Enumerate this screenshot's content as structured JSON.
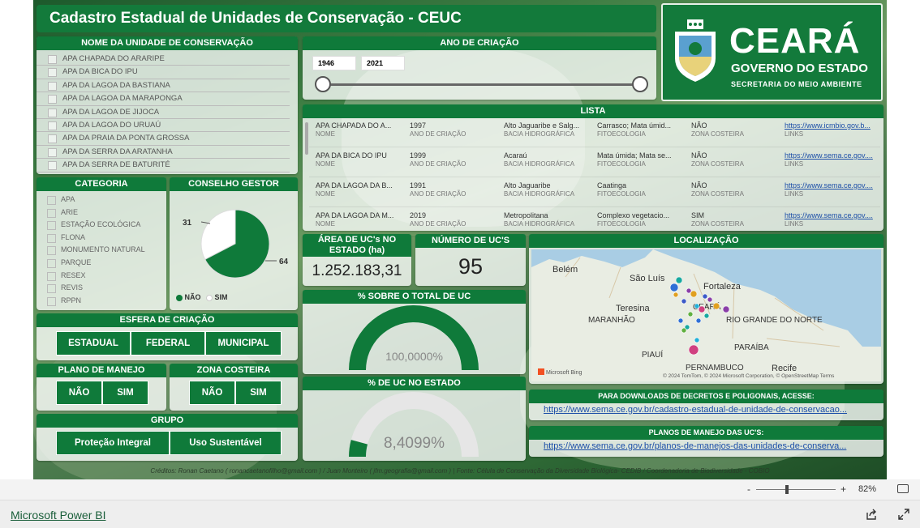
{
  "title": "Cadastro Estadual de Unidades de Conservação - CEUC",
  "logo": {
    "state": "CEARÁ",
    "gov": "GOVERNO DO ESTADO",
    "sec": "SECRETARIA DO MEIO AMBIENTE"
  },
  "nome_uc": {
    "header": "NOME DA UNIDADE DE CONSERVAÇÃO",
    "items": [
      "APA CHAPADA DO ARARIPE",
      "APA DA BICA DO IPU",
      "APA DA LAGOA DA BASTIANA",
      "APA DA LAGOA DA MARAPONGA",
      "APA DA LAGOA DE JIJOCA",
      "APA DA LAGOA DO URUAÚ",
      "APA DA PRAIA DA PONTA GROSSA",
      "APA DA SERRA DA ARATANHA",
      "APA DA SERRA DE BATURITÉ"
    ]
  },
  "ano": {
    "header": "ANO DE CRIAÇÃO",
    "min": "1946",
    "max": "2021"
  },
  "lista": {
    "header": "LISTA",
    "labels": {
      "nome": "NOME",
      "ano": "ANO DE CRIAÇÃO",
      "bacia": "BACIA HIDROGRÁFICA",
      "fito": "FITOECOLOGIA",
      "zona": "ZONA COSTEIRA",
      "links": "LINKS"
    },
    "rows": [
      {
        "nome": "APA CHAPADA DO A...",
        "ano": "1997",
        "bacia": "Alto Jaguaribe e Salg...",
        "fito": "Carrasco; Mata úmid...",
        "zona": "NÃO",
        "link": "https://www.icmbio.gov.b..."
      },
      {
        "nome": "APA DA BICA DO IPU",
        "ano": "1999",
        "bacia": "Acaraú",
        "fito": "Mata úmida; Mata se...",
        "zona": "NÃO",
        "link": "https://www.sema.ce.gov...."
      },
      {
        "nome": "APA DA LAGOA DA B...",
        "ano": "1991",
        "bacia": "Alto Jaguaribe",
        "fito": "Caatinga",
        "zona": "NÃO",
        "link": "https://www.sema.ce.gov...."
      },
      {
        "nome": "APA DA LAGOA DA M...",
        "ano": "2019",
        "bacia": "Metropolitana",
        "fito": "Complexo vegetacio...",
        "zona": "SIM",
        "link": "https://www.sema.ce.gov...."
      }
    ]
  },
  "categoria": {
    "header": "CATEGORIA",
    "items": [
      "APA",
      "ARIE",
      "ESTAÇÃO ECOLÓGICA",
      "FLONA",
      "MONUMENTO NATURAL",
      "PARQUE",
      "RESEX",
      "REVIS",
      "RPPN"
    ]
  },
  "conselho": {
    "header": "CONSELHO GESTOR",
    "nao": 64,
    "sim": 31,
    "nao_label": "NÃO",
    "sim_label": "SIM",
    "nao_color": "#0f7a3a",
    "sim_color": "#ffffff"
  },
  "area": {
    "header": "ÁREA DE UC's NO ESTADO (ha)",
    "value": "1.252.183,31"
  },
  "numero": {
    "header": "NÚMERO DE UC'S",
    "value": "95"
  },
  "pct_total": {
    "header": "% SOBRE O TOTAL DE UC",
    "value": "100,0000%",
    "fraction": 1.0
  },
  "pct_estado": {
    "header": "% DE UC NO ESTADO",
    "value": "8,4099%",
    "fraction": 0.084099
  },
  "esfera": {
    "header": "ESFERA DE CRIAÇÃO",
    "buttons": [
      "ESTADUAL",
      "FEDERAL",
      "MUNICIPAL"
    ]
  },
  "plano": {
    "header": "PLANO DE MANEJO",
    "buttons": [
      "NÃO",
      "SIM"
    ]
  },
  "zona": {
    "header": "ZONA COSTEIRA",
    "buttons": [
      "NÃO",
      "SIM"
    ]
  },
  "grupo": {
    "header": "GRUPO",
    "buttons": [
      "Proteção Integral",
      "Uso Sustentável"
    ]
  },
  "localizacao": {
    "header": "LOCALIZAÇÃO",
    "labels": [
      "Belém",
      "São Luís",
      "Fortaleza",
      "Teresina",
      "CEARÁ",
      "RIO GRANDE DO NORTE",
      "MARANHÃO",
      "PIAUÍ",
      "PARAÍBA",
      "PERNAMBUCO",
      "Recife"
    ],
    "attribution": "© 2024 TomTom, © 2024 Microsoft Corporation, © OpenStreetMap  Terms",
    "bing": "Microsoft Bing"
  },
  "downloads": {
    "header": "PARA DOWNLOADS DE DECRETOS E POLIGONAIS, ACESSE:",
    "link": "https://www.sema.ce.gov.br/cadastro-estadual-de-unidade-de-conservacao..."
  },
  "planos": {
    "header": "PLANOS DE MANEJO DAS UC'S:",
    "link": "https://www.sema.ce.gov.br/planos-de-manejos-das-unidades-de-conserva..."
  },
  "credits": "Créditos: Ronan Caetano ( ronancaetanofilho@gmail.com ) / Juan Monteiro ( jfm.geografia@gmail.com )  |  Fonte: Célula de Conservação da Diversidade Biológica- CEDIB / Coordenadoria de Biodiversidade - COBIO",
  "zoom": "82%",
  "zoom_minus": "-",
  "zoom_plus": "+",
  "brand": "Microsoft Power BI"
}
